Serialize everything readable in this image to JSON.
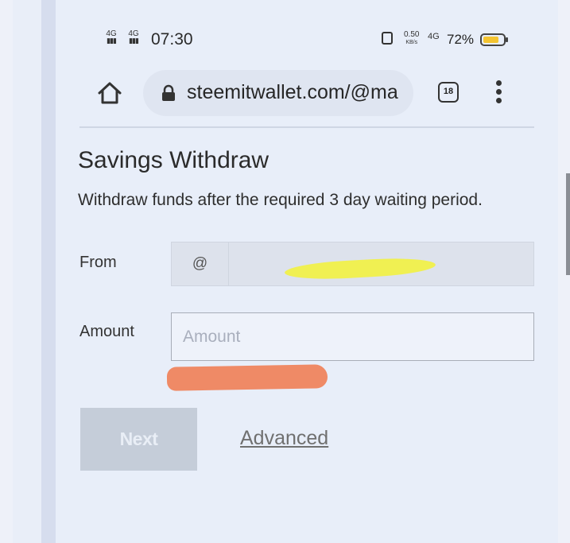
{
  "status_bar": {
    "sim1": "4G",
    "sim2": "4G",
    "time": "07:30",
    "speed_value": "0.50",
    "speed_unit": "KB/s",
    "network": "4G",
    "battery": "72%"
  },
  "browser": {
    "url": "steemitwallet.com/@ma",
    "tab_count": "18"
  },
  "page": {
    "title": "Savings Withdraw",
    "subtitle": "Withdraw funds after the required 3 day waiting period."
  },
  "form": {
    "from_label": "From",
    "at_symbol": "@",
    "from_value": "",
    "amount_label": "Amount",
    "amount_placeholder": "Amount"
  },
  "actions": {
    "next_label": "Next",
    "advanced_label": "Advanced"
  },
  "colors": {
    "background": "#e8eef9",
    "button_disabled": "#c5cdd9",
    "highlight_yellow": "#f0f04a",
    "redaction_orange": "#ef8a66"
  }
}
